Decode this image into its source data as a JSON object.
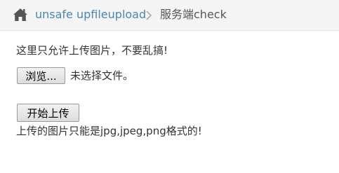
{
  "breadcrumb": {
    "home_icon": "home-icon",
    "link_text": "unsafe upfileupload",
    "separator_icon": "chevron-right-icon",
    "current_text": "服务端check"
  },
  "main": {
    "intro_text": "这里只允许上传图片，不要乱搞!",
    "browse_button_label": "浏览...",
    "file_status_text": "未选择文件。",
    "upload_button_label": "开始上传",
    "hint_text": "上传的图片只能是jpg,jpeg,png格式的!"
  },
  "colors": {
    "link": "#4a86b5",
    "breadcrumb_bg": "#f5f5f5",
    "text": "#333333"
  }
}
